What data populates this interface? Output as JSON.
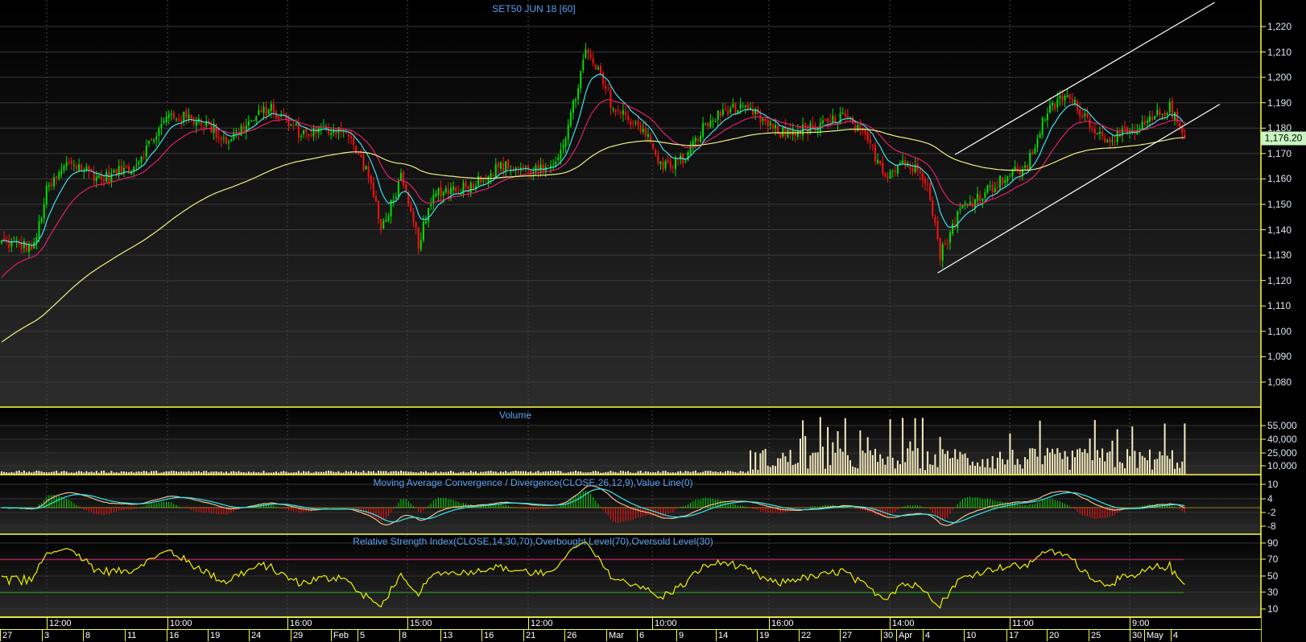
{
  "title": "SET50 JUN 18   [60]",
  "last_price": "1,176.20",
  "panels": {
    "volume": "Volume",
    "macd": "Moving Average Convergence / Divergence(CLOSE,26,12,9),Value Line(0)",
    "rsi": "Relative Strength Index(CLOSE,14,30,70),Overbought Level(70),Oversold Level(30)"
  },
  "axes": {
    "price": [
      "1,220",
      "1,210",
      "1,200",
      "1,190",
      "1,180",
      "1,170",
      "1,160",
      "1,150",
      "1,140",
      "1,130",
      "1,120",
      "1,110",
      "1,100",
      "1,090",
      "1,080"
    ],
    "volume": [
      "55,000",
      "40,000",
      "25,000",
      "10,000"
    ],
    "macd": [
      "10",
      "4",
      "-2",
      "-8"
    ],
    "rsi": [
      "90",
      "70",
      "50",
      "30",
      "10"
    ]
  },
  "time_labels": [
    "12:00",
    "10:00",
    "16:00",
    "15:00",
    "12:00",
    "10:00",
    "16:00",
    "14:00",
    "11:00",
    "9:00"
  ],
  "date_labels": [
    "27",
    "3",
    "8",
    "11",
    "16",
    "19",
    "24",
    "29",
    "Feb",
    "5",
    "8",
    "13",
    "16",
    "21",
    "26",
    "Mar",
    "6",
    "9",
    "14",
    "19",
    "22",
    "27",
    "30",
    "Apr",
    "4",
    "10",
    "17",
    "20",
    "25",
    "30",
    "May",
    "4"
  ],
  "colors": {
    "up": "#00e000",
    "down": "#ff1010",
    "ema_fast": "#40e0f0",
    "ema_mid": "#e0206a",
    "ema_slow": "#f0f080",
    "axis": "#ffff40",
    "volume": "#f5ecc0"
  },
  "chart_data": {
    "type": "candlestick",
    "bars": 475,
    "ylim": [
      1075,
      1225
    ],
    "close_path": [
      [
        0,
        1135
      ],
      [
        13,
        1133
      ],
      [
        18,
        1155
      ],
      [
        27,
        1167
      ],
      [
        40,
        1160
      ],
      [
        53,
        1165
      ],
      [
        67,
        1185
      ],
      [
        80,
        1183
      ],
      [
        90,
        1175
      ],
      [
        107,
        1188
      ],
      [
        120,
        1178
      ],
      [
        137,
        1180
      ],
      [
        147,
        1162
      ],
      [
        152,
        1140
      ],
      [
        160,
        1160
      ],
      [
        167,
        1135
      ],
      [
        174,
        1155
      ],
      [
        187,
        1157
      ],
      [
        200,
        1165
      ],
      [
        220,
        1163
      ],
      [
        227,
        1180
      ],
      [
        234,
        1210
      ],
      [
        240,
        1200
      ],
      [
        245,
        1188
      ],
      [
        257,
        1180
      ],
      [
        264,
        1165
      ],
      [
        274,
        1168
      ],
      [
        281,
        1180
      ],
      [
        291,
        1188
      ],
      [
        301,
        1186
      ],
      [
        311,
        1178
      ],
      [
        327,
        1180
      ],
      [
        337,
        1185
      ],
      [
        347,
        1175
      ],
      [
        354,
        1162
      ],
      [
        361,
        1167
      ],
      [
        371,
        1160
      ],
      [
        376,
        1130
      ],
      [
        384,
        1148
      ],
      [
        401,
        1160
      ],
      [
        411,
        1165
      ],
      [
        418,
        1185
      ],
      [
        426,
        1193
      ],
      [
        434,
        1185
      ],
      [
        441,
        1176
      ],
      [
        454,
        1178
      ],
      [
        463,
        1185
      ],
      [
        468,
        1188
      ],
      [
        474,
        1176.2
      ]
    ],
    "moving_averages": [
      {
        "name": "EMA fast",
        "period": 10
      },
      {
        "name": "EMA mid",
        "period": 25
      },
      {
        "name": "EMA slow",
        "period": 110
      }
    ],
    "trend_channel": {
      "upper": [
        [
          382,
          1169.6
        ],
        [
          486,
          1229.5
        ]
      ],
      "lower": [
        [
          375,
          1123
        ],
        [
          488,
          1189.4
        ]
      ]
    },
    "volume_ylim": [
      0,
      70000
    ],
    "macd": {
      "fast": 12,
      "slow": 26,
      "signal": 9,
      "ylim": [
        -10,
        11
      ]
    },
    "rsi": {
      "period": 14,
      "overbought": 70,
      "oversold": 30,
      "ylim": [
        0,
        100
      ]
    }
  }
}
